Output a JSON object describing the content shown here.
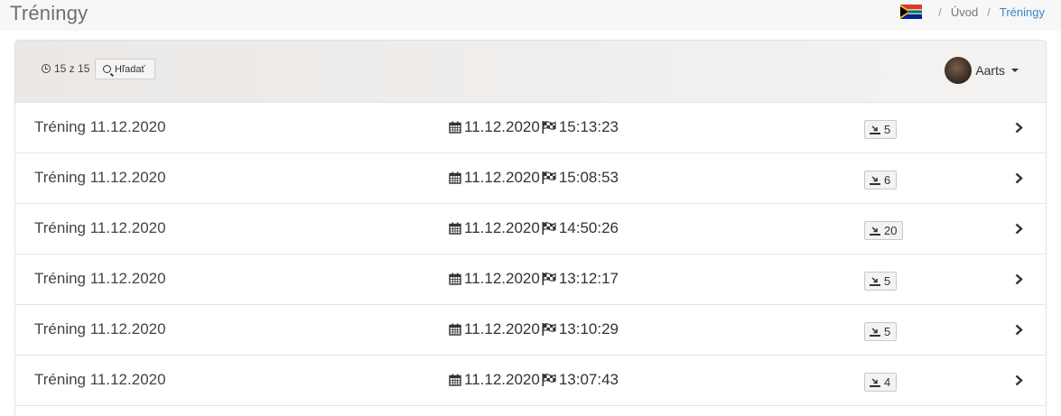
{
  "header": {
    "title": "Tréningy",
    "breadcrumb": {
      "separator": "/",
      "home": "Úvod",
      "current": "Tréningy"
    }
  },
  "toolbar": {
    "counter": "15 z 15",
    "search_label": "Hľadať",
    "user_name": "Aarts"
  },
  "trainings": [
    {
      "name": "Tréning 11.12.2020",
      "date": "11.12.2020",
      "time": "15:13:23",
      "count": "5"
    },
    {
      "name": "Tréning 11.12.2020",
      "date": "11.12.2020",
      "time": "15:08:53",
      "count": "6"
    },
    {
      "name": "Tréning 11.12.2020",
      "date": "11.12.2020",
      "time": "14:50:26",
      "count": "20"
    },
    {
      "name": "Tréning 11.12.2020",
      "date": "11.12.2020",
      "time": "13:12:17",
      "count": "5"
    },
    {
      "name": "Tréning 11.12.2020",
      "date": "11.12.2020",
      "time": "13:10:29",
      "count": "5"
    },
    {
      "name": "Tréning 11.12.2020",
      "date": "11.12.2020",
      "time": "13:07:43",
      "count": "4"
    }
  ],
  "icons": {
    "flag": "south-africa-flag-icon",
    "counter": "clock-icon",
    "search": "search-icon",
    "date": "calendar-icon",
    "time": "checkered-flag-icon",
    "count": "download-icon",
    "row_action": "chevron-right-icon"
  },
  "colors": {
    "accent_link": "#3a85c5",
    "toolbar_bg": "#efedeb"
  }
}
